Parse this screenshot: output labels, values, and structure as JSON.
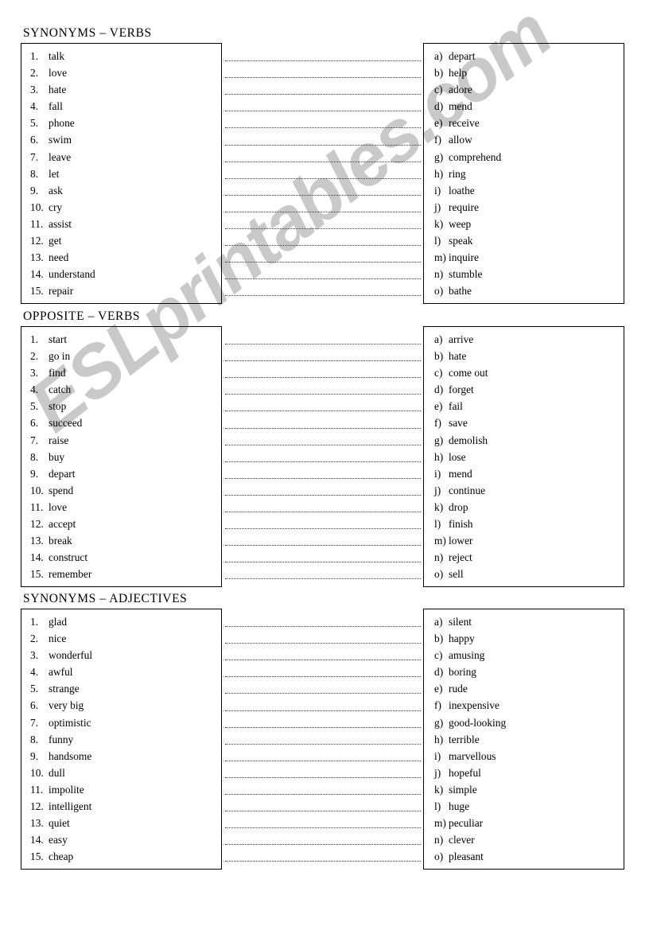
{
  "watermark": {
    "text": "ESLprintables.com"
  },
  "worksheet": {
    "sections": [
      {
        "title": "SYNONYMS – VERBS",
        "left_items": [
          {
            "marker": "1.",
            "word": "talk"
          },
          {
            "marker": "2.",
            "word": "love"
          },
          {
            "marker": "3.",
            "word": "hate"
          },
          {
            "marker": "4.",
            "word": "fall"
          },
          {
            "marker": "5.",
            "word": "phone"
          },
          {
            "marker": "6.",
            "word": "swim"
          },
          {
            "marker": "7.",
            "word": "leave"
          },
          {
            "marker": "8.",
            "word": "let"
          },
          {
            "marker": "9.",
            "word": "ask"
          },
          {
            "marker": "10.",
            "word": "cry"
          },
          {
            "marker": "11.",
            "word": "assist"
          },
          {
            "marker": "12.",
            "word": "get"
          },
          {
            "marker": "13.",
            "word": "need"
          },
          {
            "marker": "14.",
            "word": "understand"
          },
          {
            "marker": "15.",
            "word": "repair"
          }
        ],
        "right_items": [
          {
            "marker": "a)",
            "word": "depart"
          },
          {
            "marker": "b)",
            "word": "help"
          },
          {
            "marker": "c)",
            "word": "adore"
          },
          {
            "marker": "d)",
            "word": "mend"
          },
          {
            "marker": "e)",
            "word": "receive"
          },
          {
            "marker": "f)",
            "word": "allow"
          },
          {
            "marker": "g)",
            "word": "comprehend"
          },
          {
            "marker": "h)",
            "word": "ring"
          },
          {
            "marker": "i)",
            "word": "loathe"
          },
          {
            "marker": "j)",
            "word": "require"
          },
          {
            "marker": "k)",
            "word": "weep"
          },
          {
            "marker": "l)",
            "word": "speak"
          },
          {
            "marker": "m)",
            "word": "inquire"
          },
          {
            "marker": "n)",
            "word": "stumble"
          },
          {
            "marker": "o)",
            "word": "bathe"
          }
        ]
      },
      {
        "title": "OPPOSITE – VERBS",
        "left_items": [
          {
            "marker": "1.",
            "word": "start"
          },
          {
            "marker": "2.",
            "word": "go in"
          },
          {
            "marker": "3.",
            "word": "find"
          },
          {
            "marker": "4.",
            "word": "catch"
          },
          {
            "marker": "5.",
            "word": "stop"
          },
          {
            "marker": "6.",
            "word": "succeed"
          },
          {
            "marker": "7.",
            "word": "raise"
          },
          {
            "marker": "8.",
            "word": "buy"
          },
          {
            "marker": "9.",
            "word": "depart"
          },
          {
            "marker": "10.",
            "word": "spend"
          },
          {
            "marker": "11.",
            "word": "love"
          },
          {
            "marker": "12.",
            "word": "accept"
          },
          {
            "marker": "13.",
            "word": "break"
          },
          {
            "marker": "14.",
            "word": "construct"
          },
          {
            "marker": "15.",
            "word": "remember"
          }
        ],
        "right_items": [
          {
            "marker": "a)",
            "word": "arrive"
          },
          {
            "marker": "b)",
            "word": "hate"
          },
          {
            "marker": "c)",
            "word": "come out"
          },
          {
            "marker": "d)",
            "word": "forget"
          },
          {
            "marker": "e)",
            "word": "fail"
          },
          {
            "marker": "f)",
            "word": "save"
          },
          {
            "marker": "g)",
            "word": "demolish"
          },
          {
            "marker": "h)",
            "word": "lose"
          },
          {
            "marker": "i)",
            "word": "mend"
          },
          {
            "marker": "j)",
            "word": "continue"
          },
          {
            "marker": "k)",
            "word": "drop"
          },
          {
            "marker": "l)",
            "word": "finish"
          },
          {
            "marker": "m)",
            "word": "lower"
          },
          {
            "marker": "n)",
            "word": "reject"
          },
          {
            "marker": "o)",
            "word": "sell"
          }
        ]
      },
      {
        "title": "SYNONYMS – ADJECTIVES",
        "left_items": [
          {
            "marker": "1.",
            "word": "glad"
          },
          {
            "marker": "2.",
            "word": "nice"
          },
          {
            "marker": "3.",
            "word": "wonderful"
          },
          {
            "marker": "4.",
            "word": "awful"
          },
          {
            "marker": "5.",
            "word": "strange"
          },
          {
            "marker": "6.",
            "word": "very big"
          },
          {
            "marker": "7.",
            "word": "optimistic"
          },
          {
            "marker": "8.",
            "word": "funny"
          },
          {
            "marker": "9.",
            "word": "handsome"
          },
          {
            "marker": "10.",
            "word": "dull"
          },
          {
            "marker": "11.",
            "word": "impolite"
          },
          {
            "marker": "12.",
            "word": "intelligent"
          },
          {
            "marker": "13.",
            "word": "quiet"
          },
          {
            "marker": "14.",
            "word": "easy"
          },
          {
            "marker": "15.",
            "word": "cheap"
          }
        ],
        "right_items": [
          {
            "marker": "a)",
            "word": "silent"
          },
          {
            "marker": "b)",
            "word": "happy"
          },
          {
            "marker": "c)",
            "word": "amusing"
          },
          {
            "marker": "d)",
            "word": "boring"
          },
          {
            "marker": "e)",
            "word": "rude"
          },
          {
            "marker": "f)",
            "word": "inexpensive"
          },
          {
            "marker": "g)",
            "word": "good-looking"
          },
          {
            "marker": "h)",
            "word": "terrible"
          },
          {
            "marker": "i)",
            "word": "marvellous"
          },
          {
            "marker": "j)",
            "word": "hopeful"
          },
          {
            "marker": "k)",
            "word": "simple"
          },
          {
            "marker": "l)",
            "word": "huge"
          },
          {
            "marker": "m)",
            "word": "peculiar"
          },
          {
            "marker": "n)",
            "word": "clever"
          },
          {
            "marker": "o)",
            "word": "pleasant"
          }
        ]
      }
    ]
  }
}
